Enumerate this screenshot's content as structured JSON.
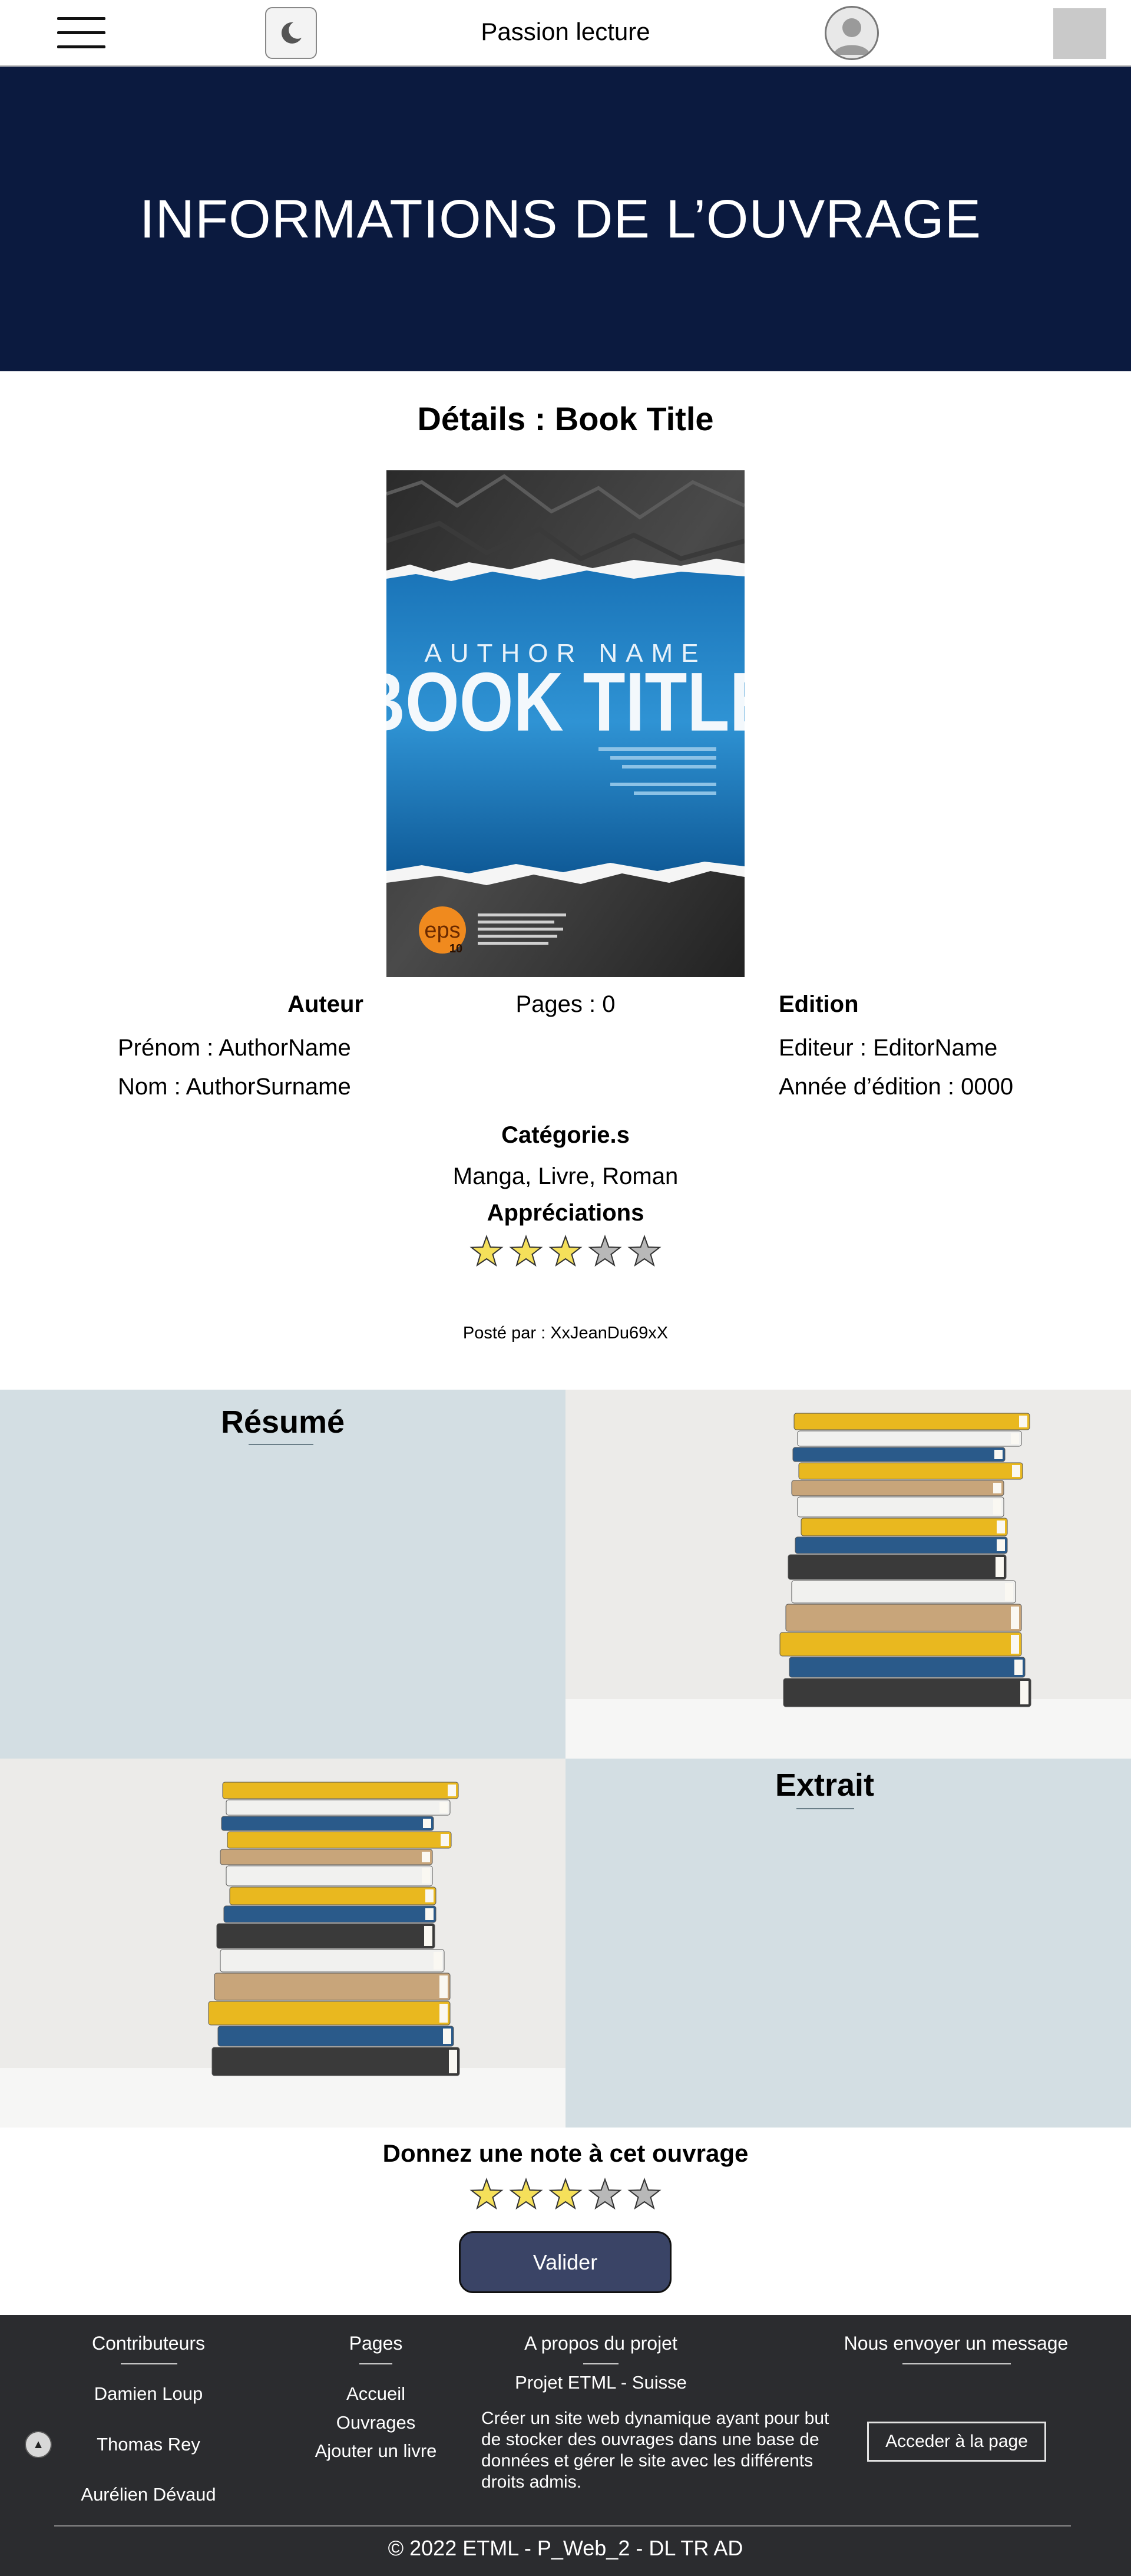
{
  "header": {
    "site_title": "Passion lecture",
    "menu_icon": "hamburger-menu-icon",
    "theme_icon": "moon-icon",
    "avatar_icon": "user-avatar-icon"
  },
  "hero": {
    "title": "INFORMATIONS DE L’OUVRAGE"
  },
  "book": {
    "details_title": "Détails : Book Title",
    "cover": {
      "author_text": "AUTHOR NAME",
      "title_text": "BOOK TITLE",
      "badge_text": "eps",
      "badge_sub": "10"
    },
    "author_heading": "Auteur",
    "first_name": "Prénom : AuthorName",
    "last_name": "Nom : AuthorSurname",
    "pages": "Pages : 0",
    "edition_heading": "Edition",
    "publisher": "Editeur : EditorName",
    "edition_year": "Année d’édition : 0000",
    "categories_heading": "Catégorie.s",
    "categories": "Manga, Livre, Roman",
    "ratings_heading": "Appréciations",
    "rating": {
      "filled": 3,
      "total": 5
    },
    "posted_by": "Posté par : XxJeanDu69xX"
  },
  "sections": {
    "resume_title": "Résumé",
    "extrait_title": "Extrait"
  },
  "rate": {
    "heading": "Donnez une note à cet ouvrage",
    "rating": {
      "filled": 3,
      "total": 5
    },
    "submit_label": "Valider"
  },
  "footer": {
    "contributors_heading": "Contributeurs",
    "contributors": [
      "Damien Loup",
      "Thomas Rey",
      "Aurélien Dévaud"
    ],
    "pages_heading": "Pages",
    "pages": [
      "Accueil",
      "Ouvrages",
      "Ajouter un livre"
    ],
    "about_heading": "A propos du projet",
    "about_subtitle": "Projet ETML - Suisse",
    "about_text": "Créer un site web dynamique ayant pour but de stocker des ouvrages dans une base de données et gérer le site avec les différents droits admis.",
    "message_heading": "Nous envoyer un message",
    "access_label": "Acceder à la page",
    "copyright": "© 2022 ETML - P_Web_2 - DL TR AD"
  },
  "colors": {
    "hero_bg": "#0b1a3f",
    "panel_bg": "#d3dee3",
    "footer_bg": "#2b2c2f",
    "button_bg": "#3a4466",
    "star_filled": "#f5e05a",
    "star_empty": "#b8b8b8"
  }
}
